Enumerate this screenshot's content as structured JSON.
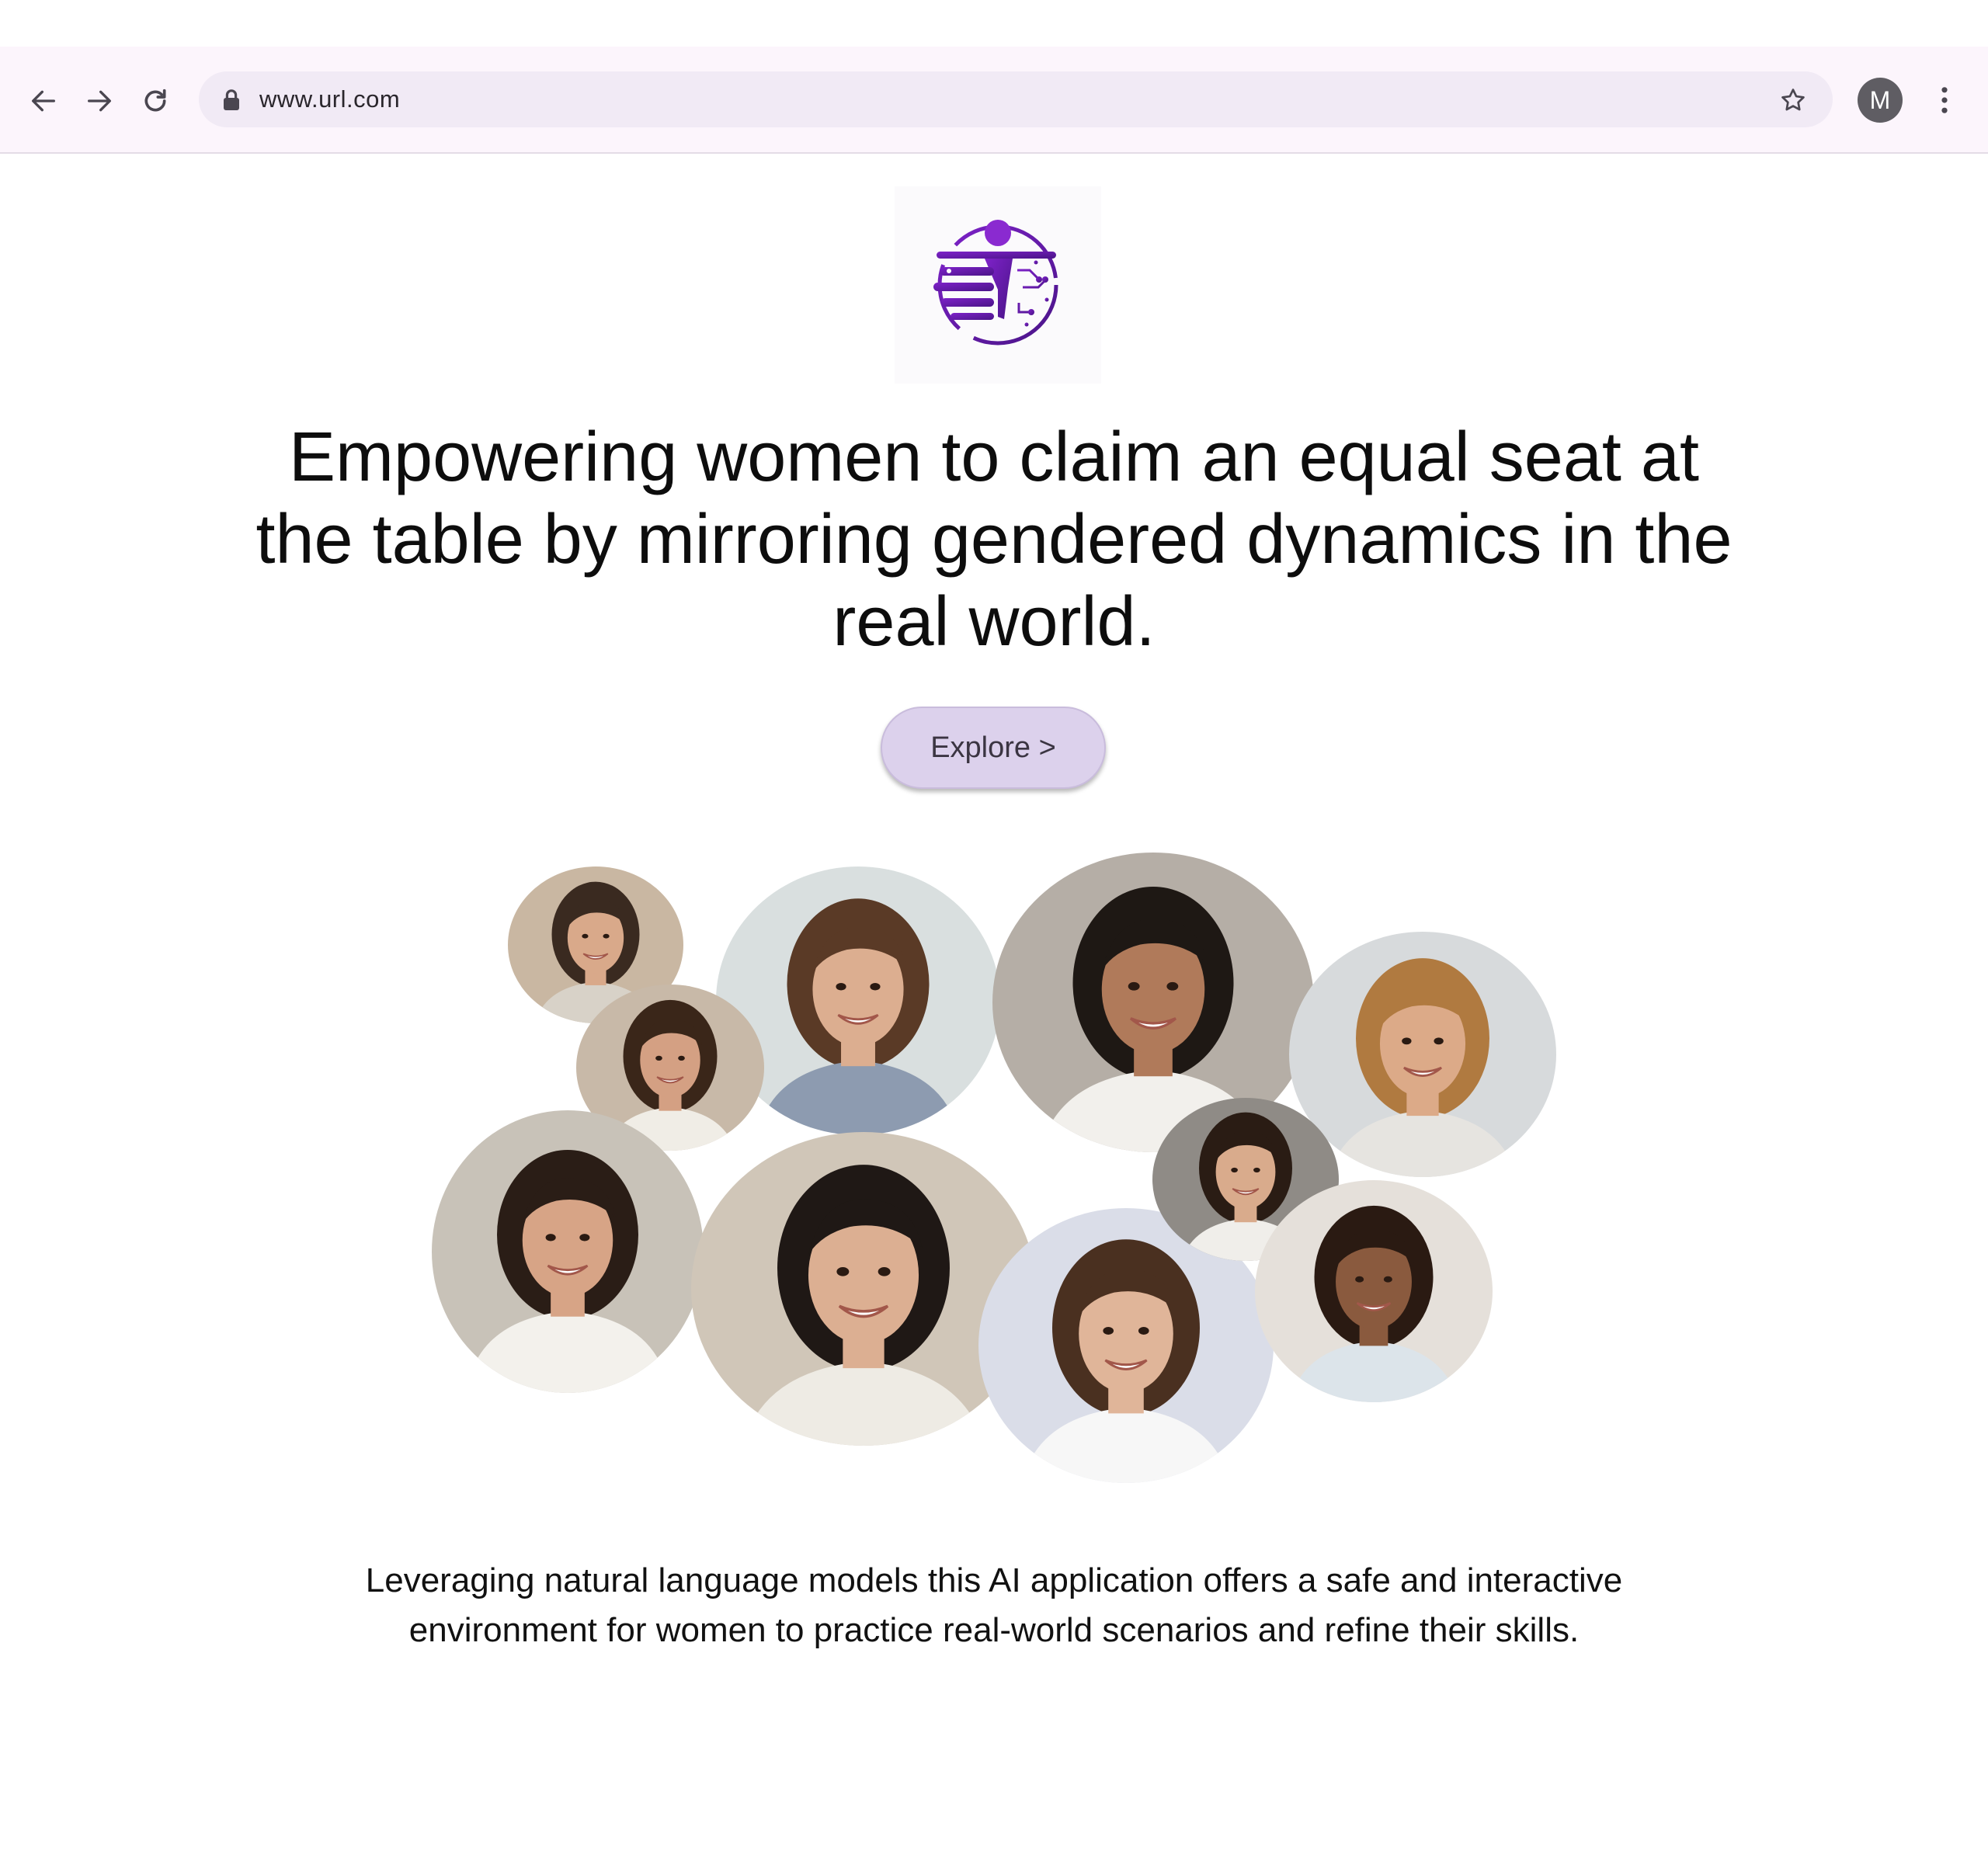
{
  "browser": {
    "url": "www.url.com",
    "profile_initial": "M",
    "icons": {
      "back": "arrow-left-icon",
      "forward": "arrow-right-icon",
      "reload": "reload-icon",
      "lock": "lock-icon",
      "bookmark": "star-icon",
      "menu": "kebab-menu-icon"
    }
  },
  "hero": {
    "logo": "logo-icon",
    "headline": "Empowering women to claim an equal seat at the table by mirroring gendered dynamics in the real world.",
    "explore_label": "Explore >"
  },
  "collage": {
    "portraits": [
      {
        "name": "portrait-1",
        "bg": "#c9b7a2",
        "skin": "#d9a98a",
        "hair": "#3a2a20",
        "shirt": "#d8d2c8"
      },
      {
        "name": "portrait-2",
        "bg": "#d9dfdf",
        "skin": "#dcae90",
        "hair": "#5a3a26",
        "shirt": "#8d9bb0"
      },
      {
        "name": "portrait-3",
        "bg": "#b5aea6",
        "skin": "#b07a5a",
        "hair": "#1e1814",
        "shirt": "#f2f0ec"
      },
      {
        "name": "portrait-4",
        "bg": "#d7dadc",
        "skin": "#dcaa88",
        "hair": "#b07a40",
        "shirt": "#e6e4e0"
      },
      {
        "name": "portrait-5",
        "bg": "#c8b9a8",
        "skin": "#d4a083",
        "hair": "#3a2619",
        "shirt": "#f0ede6"
      },
      {
        "name": "portrait-6",
        "bg": "#c8c2b8",
        "skin": "#d7a486",
        "hair": "#2a1d16",
        "shirt": "#f3f1ec"
      },
      {
        "name": "portrait-7",
        "bg": "#d0c6b8",
        "skin": "#dcaf92",
        "hair": "#1f1815",
        "shirt": "#eeebe4"
      },
      {
        "name": "portrait-8",
        "bg": "#dadde8",
        "skin": "#e0b599",
        "hair": "#4a3020",
        "shirt": "#f7f7f7"
      },
      {
        "name": "portrait-9",
        "bg": "#8f8b86",
        "skin": "#d9ab8c",
        "hair": "#2a1c14",
        "shirt": "#f0eeea"
      },
      {
        "name": "portrait-10",
        "bg": "#e5e0da",
        "skin": "#8a5a3e",
        "hair": "#2a1a12",
        "shirt": "#dce4ea"
      }
    ]
  },
  "description": "Leveraging natural language models this AI application offers a safe and interactive environment for women to practice real-world scenarios and refine their skills."
}
